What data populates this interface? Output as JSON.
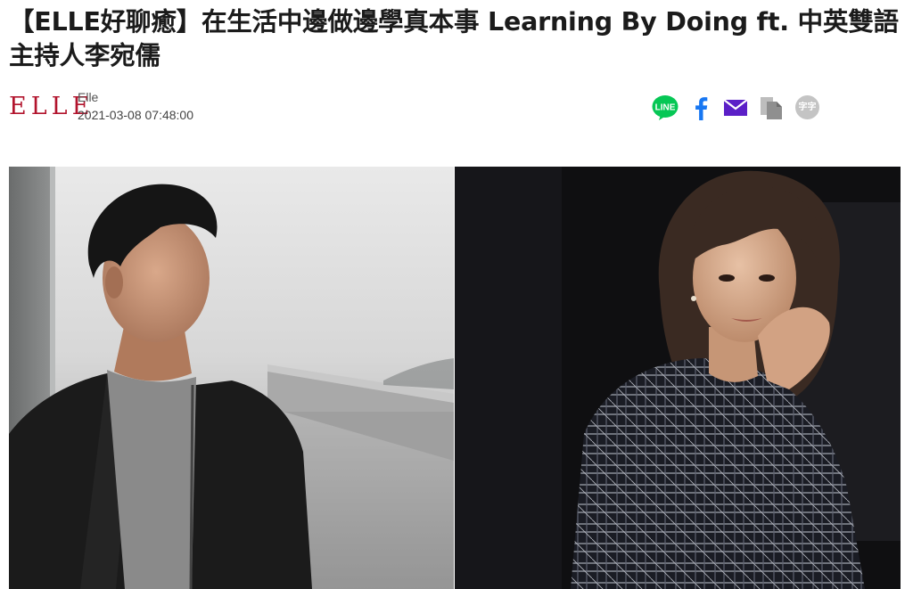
{
  "article": {
    "title": "【ELLE好聊癒】在生活中邊做邊學真本事 Learning By Doing ft. 中英雙語主持人李宛儒",
    "brand_logo_text": "ELLE",
    "author": "Elle",
    "published": "2021-03-08 07:48:00"
  },
  "share": {
    "line_label": "LINE",
    "font_size_label": "字字",
    "icons": [
      "line-icon",
      "facebook-icon",
      "mail-icon",
      "copy-icon",
      "font-size-icon"
    ],
    "colors": {
      "line": "#06c755",
      "facebook": "#1877f2",
      "mail": "#5b1fc7",
      "copy": "#9a9a9a",
      "font_size": "#c4c4c4"
    }
  },
  "colors": {
    "brand": "#b2142d",
    "title": "#1b1b1b",
    "meta_text": "#444444"
  }
}
